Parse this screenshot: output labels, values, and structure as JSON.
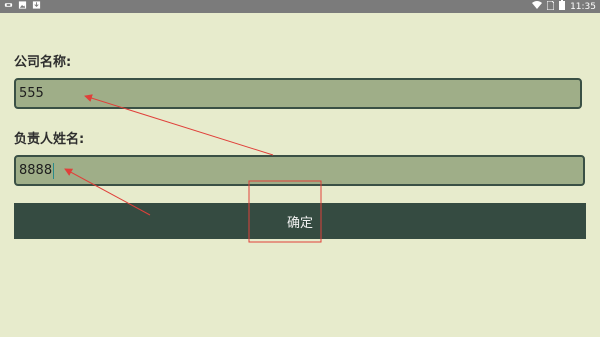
{
  "status_bar": {
    "left_icons": [
      "usb-icon",
      "image-icon",
      "download-icon"
    ],
    "right_icons": [
      "wifi-icon",
      "sim-icon",
      "battery-icon"
    ],
    "time": "11:35"
  },
  "form": {
    "company_label": "公司名称:",
    "company_value": "555",
    "manager_label": "负责人姓名:",
    "manager_value": "8888",
    "confirm_label": "确定"
  },
  "colors": {
    "background": "#e7ebcc",
    "field_fill": "#9fae88",
    "field_border": "#3a5045",
    "button": "#354b41",
    "annotation": "#e0403a"
  }
}
